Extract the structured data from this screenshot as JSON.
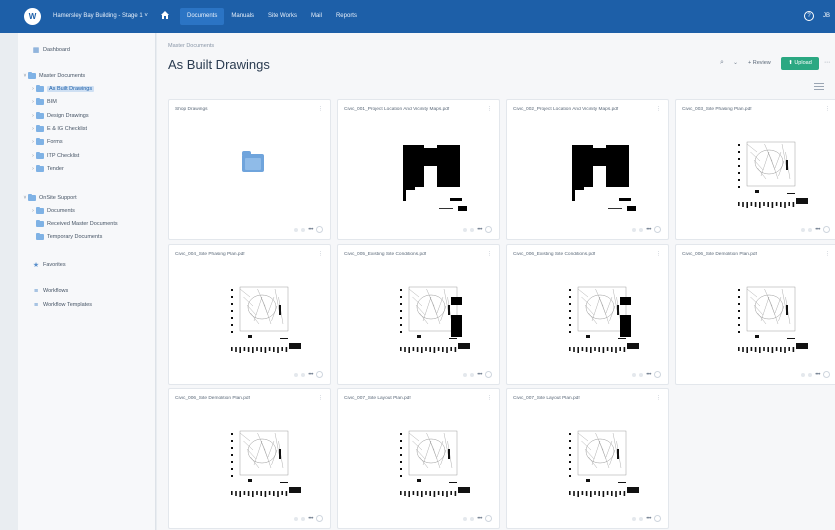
{
  "topbar": {
    "logo_text": "W",
    "project": "Hamersley Bay Building - Stage 1 ˅",
    "nav": [
      "Documents",
      "Manuals",
      "Site Works",
      "Mail",
      "Reports"
    ],
    "active_nav": "Documents",
    "help": "?",
    "avatar": "JB"
  },
  "sidebar": {
    "dashboard": "Dashboard",
    "master_documents": "Master Documents",
    "master_children": [
      "As Built Drawings",
      "BIM",
      "Design Drawings",
      "E & IG Checklist",
      "Forms",
      "ITP Checklist",
      "Tender"
    ],
    "selected": "As Built Drawings",
    "onsite_support": "OnSite Support",
    "onsite_children": [
      "Documents",
      "Received Master Documents",
      "Temporary Documents"
    ],
    "favorites": "Favorites",
    "workflows": "Workflows",
    "workflow_templates": "Workflow Templates"
  },
  "main": {
    "breadcrumb": "Master Documents",
    "title": "As Built Drawings",
    "review_label": "+ Review",
    "upload_label": "⬆ Upload",
    "files": [
      {
        "name": "Shop Drawings",
        "kind": "folder"
      },
      {
        "name": "Civic_001_Project Location And Vicinity Maps.pdf",
        "kind": "map"
      },
      {
        "name": "Civic_002_Project Location And Vicinity Maps.pdf",
        "kind": "map"
      },
      {
        "name": "Civic_003_Site Phasing Plan.pdf",
        "kind": "plan"
      },
      {
        "name": "Civic_004_Site Phasing Plan.pdf",
        "kind": "plan"
      },
      {
        "name": "Civic_005_Existing Site Conditions.pdf",
        "kind": "plan2"
      },
      {
        "name": "Civic_006_Existing Site Conditions.pdf",
        "kind": "plan2"
      },
      {
        "name": "Civic_006_Site Demolition Plan.pdf",
        "kind": "plan"
      },
      {
        "name": "Civic_006_Site Demolition Plan.pdf",
        "kind": "plan"
      },
      {
        "name": "Civic_007_Site Layout Plan.pdf",
        "kind": "plan"
      },
      {
        "name": "Civic_007_Site Layout Plan.pdf",
        "kind": "plan"
      }
    ]
  }
}
